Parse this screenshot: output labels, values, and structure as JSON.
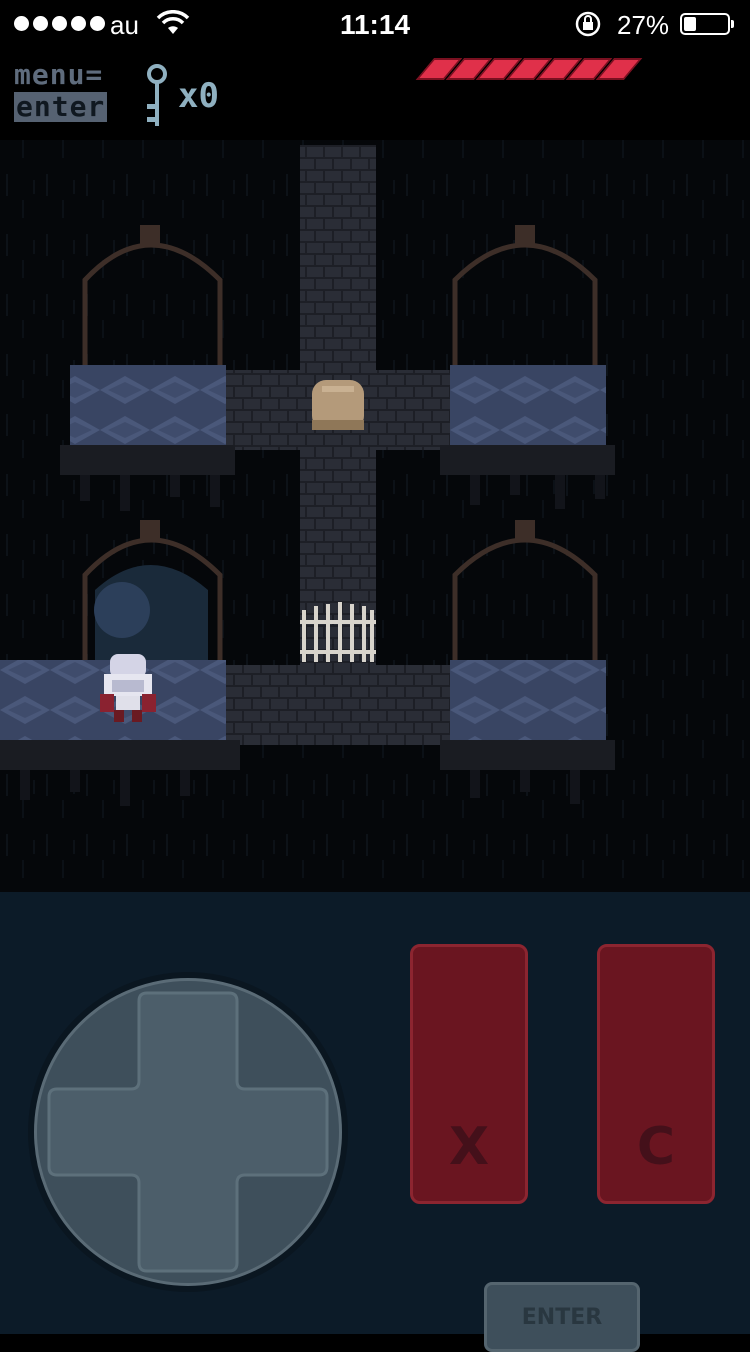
{
  "status_bar": {
    "carrier": "au",
    "time": "11:14",
    "battery_percent": "27%"
  },
  "hud": {
    "menu_label": "menu=",
    "enter_label": "enter",
    "key_count_prefix": "x",
    "key_count": "0",
    "health_segments": 7
  },
  "controls": {
    "x_label": "X",
    "c_label": "C",
    "enter_label": "ENTER"
  },
  "colors": {
    "health": "#e0304a",
    "action_button": "#6a1520",
    "control_panel": "#0c1b28"
  }
}
